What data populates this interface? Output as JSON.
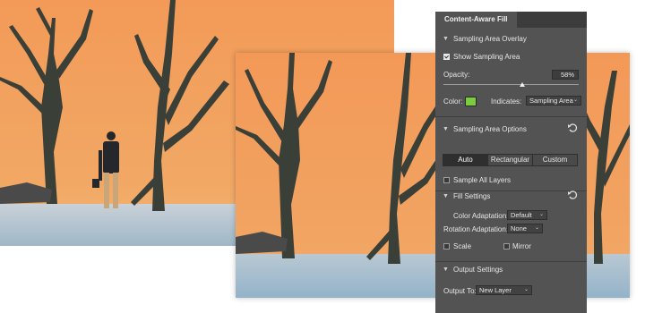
{
  "panel": {
    "tab_title": "Content-Aware Fill",
    "sampling_overlay": {
      "header": "Sampling Area Overlay",
      "show_label": "Show Sampling Area",
      "show_checked": true,
      "opacity_label": "Opacity:",
      "opacity_value": "58%",
      "opacity_fraction": 0.58,
      "color_label": "Color:",
      "color_hex": "#7ccd3e",
      "indicates_label": "Indicates:",
      "indicates_value": "Sampling Area"
    },
    "sampling_options": {
      "header": "Sampling Area Options",
      "buttons": [
        "Auto",
        "Rectangular",
        "Custom"
      ],
      "active": "Auto",
      "sample_all_label": "Sample All Layers",
      "sample_all_checked": false
    },
    "fill_settings": {
      "header": "Fill Settings",
      "color_adaptation_label": "Color Adaptation:",
      "color_adaptation_value": "Default",
      "rotation_adaptation_label": "Rotation Adaptation:",
      "rotation_adaptation_value": "None",
      "scale_label": "Scale",
      "mirror_label": "Mirror"
    },
    "output_settings": {
      "header": "Output Settings",
      "output_to_label": "Output To:",
      "output_to_value": "New Layer"
    }
  },
  "colors": {
    "panel_bg": "#535353",
    "sky": "#f2a05e",
    "ground": "#b8c6d2"
  },
  "icons": {
    "expand": "chevron-down-icon",
    "reset": "reset-icon",
    "dropdown": "dropdown-caret-icon"
  }
}
